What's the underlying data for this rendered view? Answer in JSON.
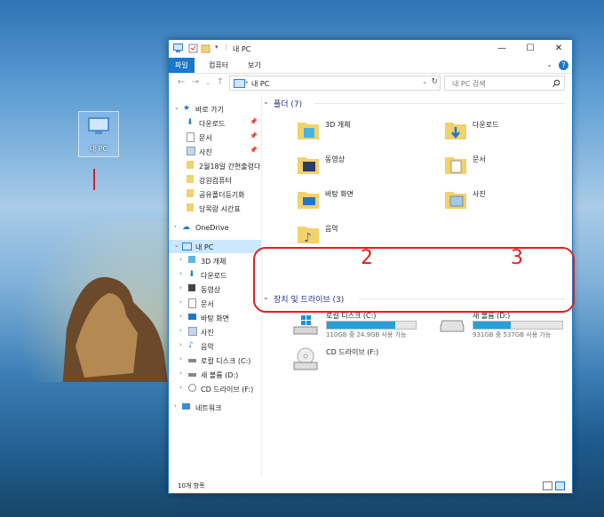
{
  "desktop": {
    "icon_label": "내 PC",
    "annotations": [
      "1",
      "2",
      "3"
    ]
  },
  "window": {
    "title": "내 PC",
    "controls": {
      "minimize": "—",
      "maximize": "☐",
      "close": "✕"
    }
  },
  "ribbon": {
    "tabs": [
      "파일",
      "컴퓨터",
      "보기"
    ],
    "help": "?"
  },
  "address": {
    "path_sep": "›",
    "path": "내 PC",
    "search_placeholder": "내 PC 검색"
  },
  "nav": {
    "quick_access": "바로 가기",
    "quick_items": [
      "다운로드",
      "문서",
      "사진",
      "2월18일 간현출렁다",
      "강원컴퓨터",
      "공유폴더등기화",
      "당목랑 시간표"
    ],
    "onedrive": "OneDrive",
    "this_pc": "내 PC",
    "pc_items": [
      "3D 개체",
      "다운로드",
      "동영상",
      "문서",
      "바탕 화면",
      "사진",
      "음악",
      "로컬 디스크 (C:)",
      "새 볼륨 (D:)",
      "CD 드라이브 (F:)"
    ],
    "network": "네트워크"
  },
  "content": {
    "folders_header": "폴더 (7)",
    "folders": [
      {
        "name": "3D 개체",
        "icon": "3d-objects-folder-icon"
      },
      {
        "name": "다운로드",
        "icon": "downloads-folder-icon"
      },
      {
        "name": "동영상",
        "icon": "videos-folder-icon"
      },
      {
        "name": "문서",
        "icon": "documents-folder-icon"
      },
      {
        "name": "바탕 화면",
        "icon": "desktop-folder-icon"
      },
      {
        "name": "사진",
        "icon": "pictures-folder-icon"
      },
      {
        "name": "음악",
        "icon": "music-folder-icon"
      }
    ],
    "drives_header": "장치 및 드라이브 (3)",
    "drives": [
      {
        "name": "로컬 디스크 (C:)",
        "info": "110GB 중 24.9GB 사용 가능",
        "used_fraction": 0.77
      },
      {
        "name": "새 볼륨 (D:)",
        "info": "931GB 중 537GB 사용 가능",
        "used_fraction": 0.42
      },
      {
        "name": "CD 드라이브 (F:)",
        "info": ""
      }
    ]
  },
  "status": {
    "items": "10개 항목"
  },
  "colors": {
    "accent": "#1979ca",
    "drive_bar": "#26a0da",
    "annotation": "#e02020"
  }
}
